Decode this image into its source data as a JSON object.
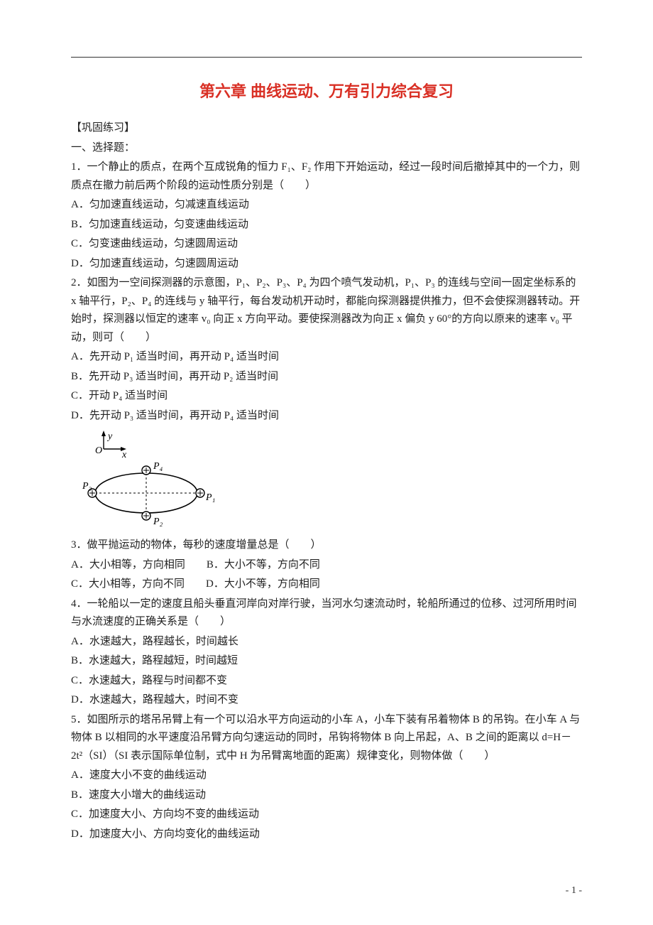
{
  "title": "第六章 曲线运动、万有引力综合复习",
  "sections": {
    "practice": "【巩固练习】",
    "choice": "一、选择题："
  },
  "q1": {
    "stem": "1．一个静止的质点，在两个互成锐角的恒力 F₁、F₂ 作用下开始运动，经过一段时间后撤掉其中的一个力，则质点在撤力前后两个阶段的运动性质分别是（　　）",
    "A": "A．匀加速直线运动，匀减速直线运动",
    "B": "B．匀加速直线运动，匀变速曲线运动",
    "C": "C．匀变速曲线运动，匀速圆周运动",
    "D": "D．匀加速直线运动，匀速圆周运动"
  },
  "q2": {
    "stem": "2．如图为一空间探测器的示意图，P₁、P₂、P₃、P₄ 为四个喷气发动机，P₁、P₃ 的连线与空间一固定坐标系的 x 轴平行，P₂、P₄ 的连线与 y 轴平行，每台发动机开动时，都能向探测器提供推力，但不会使探测器转动。开始时，探测器以恒定的速率 v₀ 向正 x 方向平动。要使探测器改为向正 x 偏负 y 60°的方向以原来的速率 v₀ 平动，则可（　　）",
    "A": " A．先开动 P₁ 适当时间，再开动 P₄ 适当时间",
    "B": "B．先开动 P₃ 适当时间，再开动 P₂ 适当时间",
    "C": "C．开动 P₄ 适当时间",
    "D": "D．先开动 P₃ 适当时间，再开动 P₄ 适当时间"
  },
  "diagram_labels": {
    "y": "y",
    "x": "x",
    "O": "O",
    "P1": "P₁",
    "P2": "P₂",
    "P3": "P₃",
    "P4": "P₄"
  },
  "q3": {
    "stem": "3．做平抛运动的物体，每秒的速度增量总是（　　）",
    "AB": "A．大小相等，方向相同　　B．大小不等，方向不同",
    "CD": "C．大小相等，方向不同　　D．大小不等，方向相同"
  },
  "q4": {
    "stem": "4．一轮船以一定的速度且船头垂直河岸向对岸行驶，当河水匀速流动时，轮船所通过的位移、过河所用时间与水流速度的正确关系是（　　）",
    "A": "A．水速越大，路程越长，时间越长",
    "B": "B．水速越大，路程越短，时间越短",
    "C": "C．水速越大，路程与时间都不变",
    "D": "D．水速越大，路程越大，时间不变"
  },
  "q5": {
    "stem": "5．如图所示的塔吊吊臂上有一个可以沿水平方向运动的小车 A，小车下装有吊着物体 B 的吊钩。在小车 A 与物体 B 以相同的水平速度沿吊臂方向匀速运动的同时，吊钩将物体 B 向上吊起，A、B 之间的距离以 d=H－2t²（SI）（SI 表示国际单位制，式中 H 为吊臂离地面的距离）规律变化，则物体做（　　）",
    "A": "A．速度大小不变的曲线运动",
    "B": "B．速度大小增大的曲线运动",
    "C": "C．加速度大小、方向均不变的曲线运动",
    "D": "D．加速度大小、方向均变化的曲线运动"
  },
  "page_num": "- 1 -"
}
